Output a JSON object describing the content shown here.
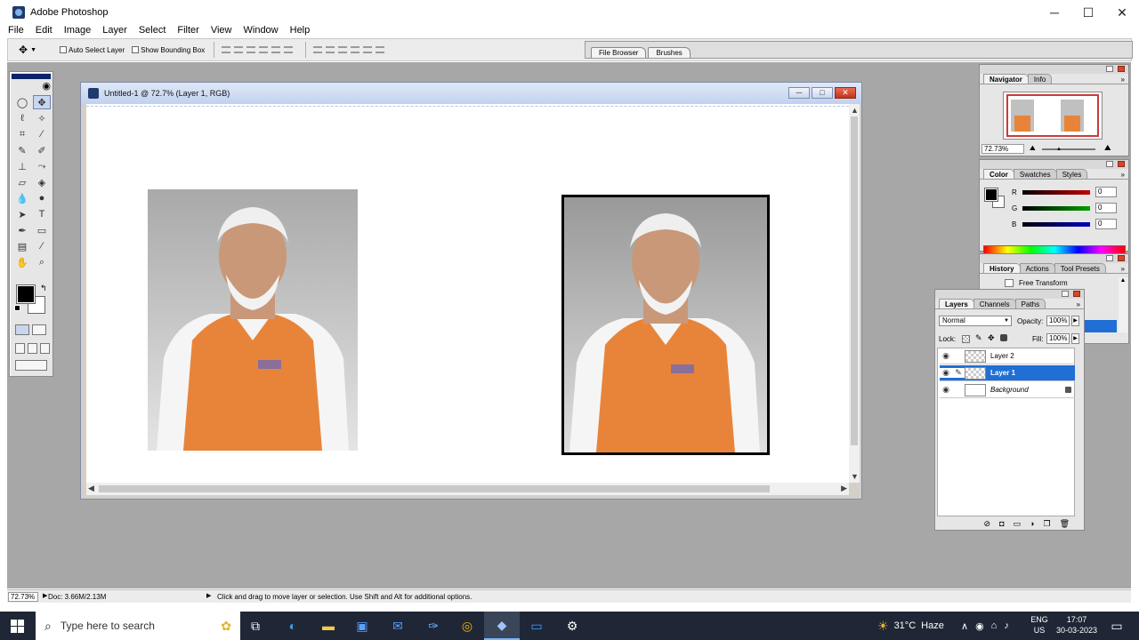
{
  "window": {
    "title": "Adobe Photoshop",
    "minimize": "─",
    "maximize": "☐",
    "close": "✕"
  },
  "menu": [
    "File",
    "Edit",
    "Image",
    "Layer",
    "Select",
    "Filter",
    "View",
    "Window",
    "Help"
  ],
  "options": {
    "auto_select": "Auto Select Layer",
    "bounding_box": "Show Bounding Box",
    "well_tabs": [
      "File Browser",
      "Brushes"
    ]
  },
  "document": {
    "title": "Untitled-1 @ 72.7% (Layer 1, RGB)",
    "ctrl_min": "─",
    "ctrl_max": "□",
    "ctrl_close": "✕"
  },
  "navigator": {
    "tabs": [
      "Navigator",
      "Info"
    ],
    "zoom": "72.73%"
  },
  "color_panel": {
    "tabs": [
      "Color",
      "Swatches",
      "Styles"
    ],
    "channels": [
      {
        "label": "R",
        "value": "0",
        "color": "#c40000"
      },
      {
        "label": "G",
        "value": "0",
        "color": "#00a000"
      },
      {
        "label": "B",
        "value": "0",
        "color": "#0000c0"
      }
    ]
  },
  "history": {
    "tabs": [
      "History",
      "Actions",
      "Tool Presets"
    ],
    "item": "Free Transform"
  },
  "layers": {
    "tabs": [
      "Layers",
      "Channels",
      "Paths"
    ],
    "blend_mode": "Normal",
    "opacity_label": "Opacity:",
    "opacity": "100%",
    "lock_label": "Lock:",
    "fill_label": "Fill:",
    "fill": "100%",
    "items": [
      {
        "name": "Layer 2",
        "selected": false
      },
      {
        "name": "Layer 1",
        "selected": true
      },
      {
        "name": "Background",
        "selected": false
      }
    ]
  },
  "status": {
    "zoom": "72.73%",
    "doc": "Doc: 3.66M/2.13M",
    "hint": "Click and drag to move layer or selection.  Use Shift and Alt for additional options."
  },
  "taskbar": {
    "search_placeholder": "Type here to search",
    "weather_temp": "31°C",
    "weather_desc": "Haze",
    "lang_top": "ENG",
    "lang_bottom": "US",
    "time": "17:07",
    "date": "30-03-2023"
  },
  "colors": {
    "workspace": "#a7a7a7",
    "vest": "#e8843a",
    "selection": "#1f6fd6",
    "taskbar": "#1f2736"
  }
}
